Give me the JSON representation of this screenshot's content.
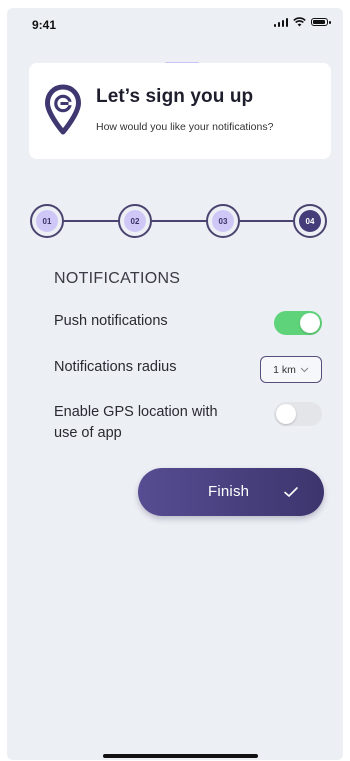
{
  "status_bar": {
    "time": "9:41"
  },
  "header": {
    "title": "Let’s sign you up",
    "subtitle": "How would you like your notifications?"
  },
  "stepper": {
    "steps": [
      "01",
      "02",
      "03",
      "04"
    ],
    "active_step": "04"
  },
  "notifications": {
    "section_title": "NOTIFICATIONS",
    "push": {
      "label": "Push notifications",
      "enabled": true
    },
    "radius": {
      "label": "Notifications radius",
      "value": "1 km"
    },
    "gps": {
      "label_line1": "Enable GPS location with",
      "label_line2": "use of app",
      "enabled": false
    }
  },
  "finish_button": {
    "label": "Finish"
  },
  "colors": {
    "background": "#eceff4",
    "accent": "#453d7a",
    "step_fill": "#cfc8f7",
    "toggle_on": "#5fd37a",
    "toggle_off": "#e3e5e9"
  },
  "icons": {
    "logo": "location-pin-logo-icon",
    "finish": "checkmark-icon",
    "dropdown": "chevron-down-icon"
  }
}
